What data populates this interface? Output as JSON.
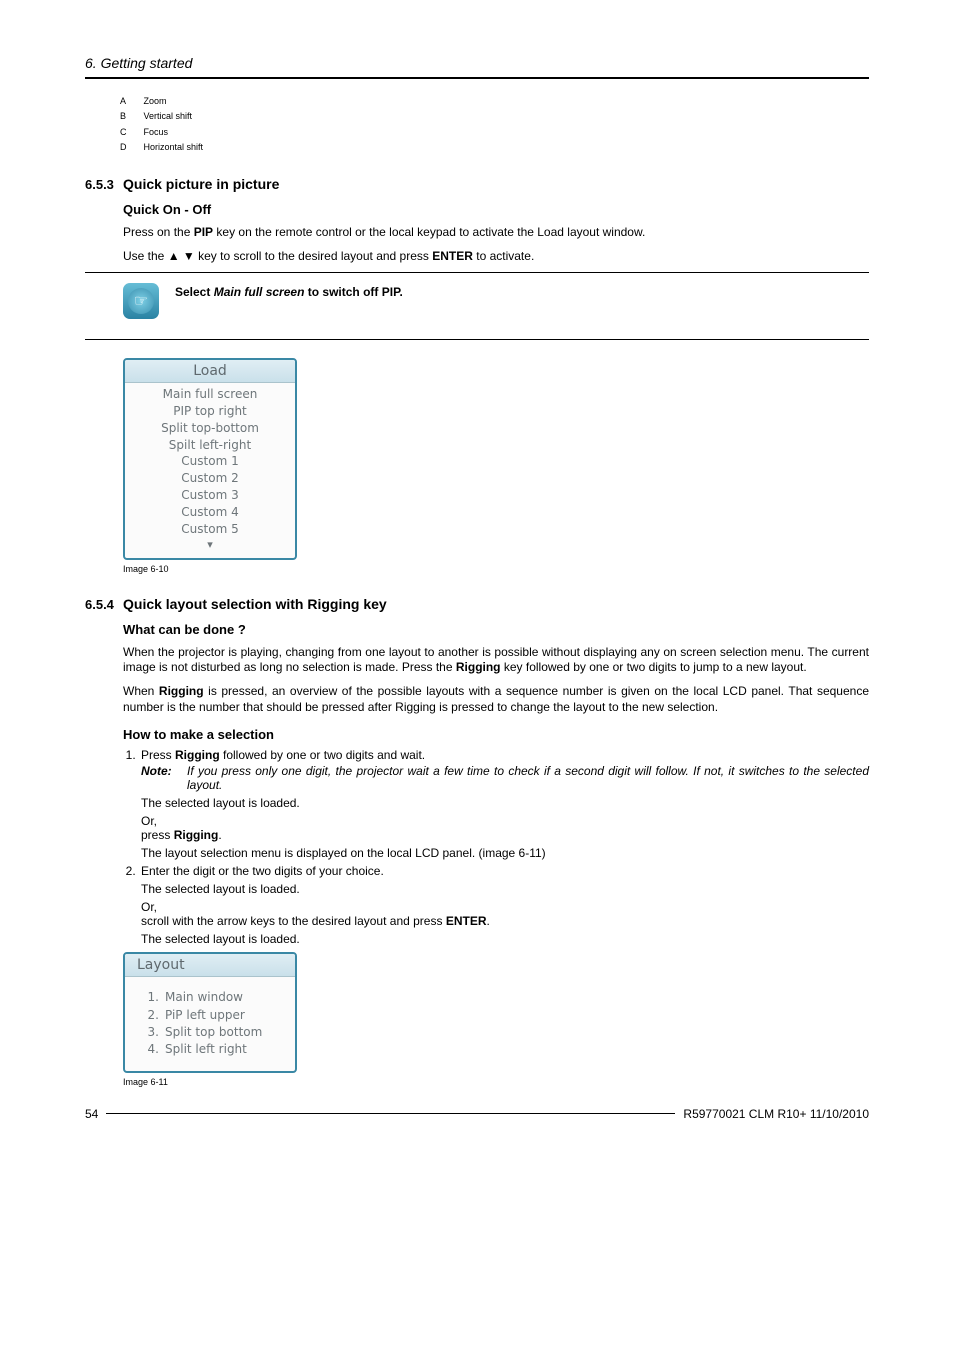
{
  "running_head": "6.  Getting started",
  "legend": [
    {
      "k": "A",
      "v": "Zoom"
    },
    {
      "k": "B",
      "v": "Vertical shift"
    },
    {
      "k": "C",
      "v": "Focus"
    },
    {
      "k": "D",
      "v": "Horizontal shift"
    }
  ],
  "sec653": {
    "num": "6.5.3",
    "title": "Quick picture in picture",
    "quick_title": "Quick On - Off",
    "p1a": "Press on the ",
    "p1b": "PIP",
    "p1c": " key on the remote control or the local keypad to activate the Load layout window.",
    "p2a": "Use the ▲ ▼ key to scroll to the desired layout and press ",
    "p2b": "ENTER",
    "p2c": " to activate.",
    "note_a": "Select ",
    "note_b": "Main full screen",
    "note_c": " to switch off PIP.",
    "load_title": "Load",
    "load_items": [
      "Main full screen",
      "PIP top right",
      "Split top-bottom",
      "Spilt left-right",
      "Custom 1",
      "Custom 2",
      "Custom 3",
      "Custom 4",
      "Custom 5"
    ],
    "caption": "Image 6-10"
  },
  "sec654": {
    "num": "6.5.4",
    "title": "Quick layout selection with Rigging key",
    "what_title": "What can be done ?",
    "p1a": "When the projector is playing, changing from one layout to another is possible without displaying any on screen selection menu. The current image is not disturbed as long no selection is made.  Press the ",
    "p1b": "Rigging",
    "p1c": " key followed by one or two digits to jump to a new layout.",
    "p2a": "When ",
    "p2b": "Rigging",
    "p2c": " is pressed, an overview of the possible layouts with a sequence number is given on the local LCD panel.  That sequence number is the number that should be pressed after Rigging is pressed to change the layout to the new selection.",
    "how_title": "How to make a selection",
    "s1a": "Press ",
    "s1b": "Rigging",
    "s1c": " followed by one or two digits and wait.",
    "s1_note_label": "Note:",
    "s1_note": "If you press only one digit, the projector wait a few time to check if a second digit will follow.  If not, it switches to the selected layout.",
    "s1_loaded": "The selected layout is loaded.",
    "or": "Or,",
    "s1_press_a": "press ",
    "s1_press_b": "Rigging",
    "s1_press_c": ".",
    "s1_menu": "The layout selection menu is displayed on the local LCD panel.  (image 6-11)",
    "s2": "Enter the digit or the two digits of your choice.",
    "s2_loaded": "The selected layout is loaded.",
    "s2_scroll_a": "scroll with the arrow keys to the desired layout and press ",
    "s2_scroll_b": "ENTER",
    "s2_scroll_c": ".",
    "s2_final": "The selected layout is loaded.",
    "layout_title": "Layout",
    "layout_items": [
      {
        "n": "1.",
        "t": "Main window"
      },
      {
        "n": "2.",
        "t": "PiP left upper"
      },
      {
        "n": "3.",
        "t": "Split top bottom"
      },
      {
        "n": "4.",
        "t": "Split left right"
      }
    ],
    "caption": "Image 6-11"
  },
  "footer": {
    "page": "54",
    "doc": "R59770021 CLM R10+ 11/10/2010"
  }
}
